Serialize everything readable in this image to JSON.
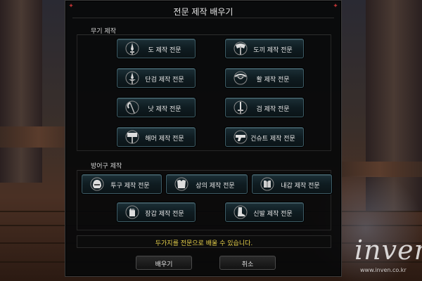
{
  "window": {
    "title": "전문 제작 배우기"
  },
  "weapon_section": {
    "label": "무기 제작",
    "buttons": [
      {
        "label": "도 제작 전문",
        "icon": "sword-icon"
      },
      {
        "label": "도끼 제작 전문",
        "icon": "axe-icon"
      },
      {
        "label": "단검 제작 전문",
        "icon": "dagger-icon"
      },
      {
        "label": "활 제작 전문",
        "icon": "bow-icon"
      },
      {
        "label": "낫 제작 전문",
        "icon": "scythe-icon"
      },
      {
        "label": "검 제작 전문",
        "icon": "blade-icon"
      },
      {
        "label": "해머 제작 전문",
        "icon": "hammer-icon"
      },
      {
        "label": "건슈트 제작 전문",
        "icon": "gun-icon"
      }
    ]
  },
  "armor_section": {
    "label": "방어구 제작",
    "buttons": [
      {
        "label": "투구 제작 전문",
        "icon": "helmet-icon"
      },
      {
        "label": "상의 제작 전문",
        "icon": "chest-armor-icon"
      },
      {
        "label": "내갑 제작 전문",
        "icon": "inner-armor-icon"
      },
      {
        "label": "장갑 제작 전문",
        "icon": "gloves-icon"
      },
      {
        "label": "신발 제작 전문",
        "icon": "boots-icon"
      }
    ]
  },
  "message": "두가지를 전문으로 배울 수 있습니다.",
  "actions": {
    "learn": "배우기",
    "cancel": "취소"
  },
  "watermark": {
    "brand": "inven",
    "url": "www.inven.co.kr"
  },
  "colors": {
    "message_text": "#e8d24a",
    "button_border": "#3e5c66",
    "corner_ornament": "#b33333"
  }
}
